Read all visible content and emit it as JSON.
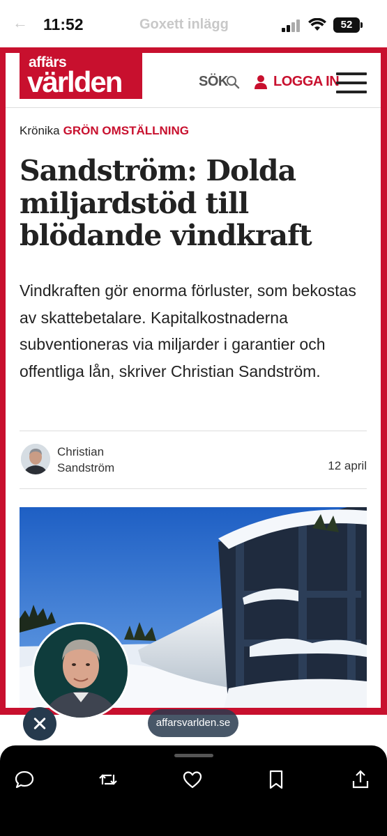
{
  "status_bar": {
    "time": "11:52",
    "ghost_title": "Goxett inlägg",
    "battery": "52"
  },
  "site": {
    "logo_top": "affärs",
    "logo_bottom": "världen",
    "search_label": "SÖK",
    "login_label": "LOGGA IN",
    "brand_color": "#c8102e"
  },
  "article": {
    "kicker_type": "Krönika",
    "kicker_topic": "GRÖN OMSTÄLLNING",
    "headline": "Sandström: Dolda miljardstöd till blödande vindkraft",
    "lede": "Vindkraften gör enorma förluster, som bekostas av skattebetalare. Kapitalkostnaderna subventioneras via miljarder i garantier och offentliga lån, skriver Christian Sandström.",
    "author": "Christian Sandström",
    "date": "12 april"
  },
  "overlay": {
    "domain": "affarsvarlden.se"
  },
  "bottom_bar": {
    "icons": [
      "reply-icon",
      "repost-icon",
      "like-icon",
      "bookmark-icon",
      "share-icon"
    ]
  }
}
